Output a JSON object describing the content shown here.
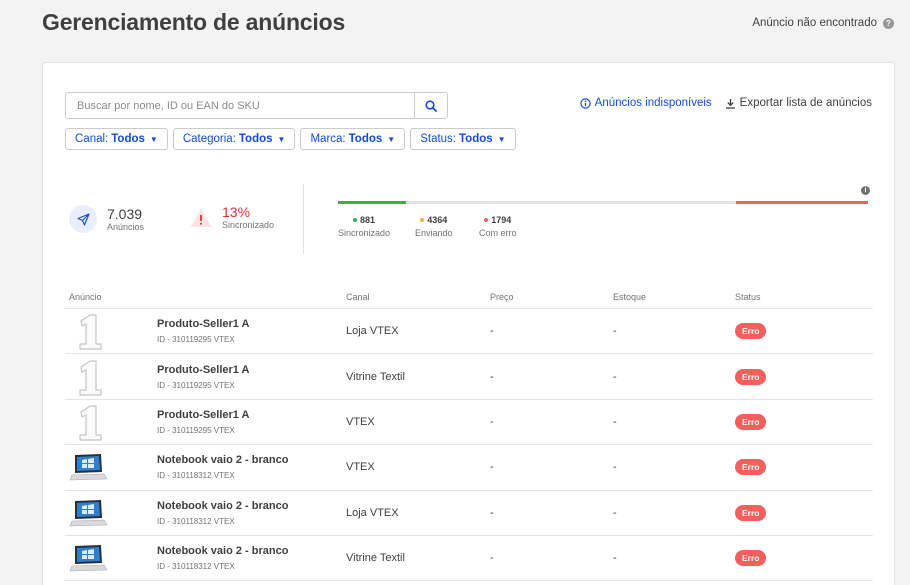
{
  "header": {
    "title": "Gerenciamento de anúncios",
    "help_link": "Anúncio não encontrado",
    "help_icon_glyph": "?"
  },
  "search": {
    "placeholder": "Buscar por nome, ID ou EAN do SKU",
    "value": ""
  },
  "links": {
    "unavailable": "Anúncios indisponíveis",
    "export": "Exportar lista de anúncios"
  },
  "filters": [
    {
      "label": "Canal:",
      "value": "Todos"
    },
    {
      "label": "Categoria:",
      "value": "Todos"
    },
    {
      "label": "Marca:",
      "value": "Todos"
    },
    {
      "label": "Status:",
      "value": "Todos"
    }
  ],
  "summary": {
    "ads_count": "7.039",
    "ads_label": "Anúncios",
    "sync_pct": "13%",
    "sync_label": "Sincronizado",
    "legend": [
      {
        "value": "881",
        "label": "Sincronizado",
        "color": "#34b347"
      },
      {
        "value": "4364",
        "label": "Enviando",
        "color": "#f0b33b"
      },
      {
        "value": "1794",
        "label": "Com erro",
        "color": "#f25f5c"
      }
    ]
  },
  "table": {
    "columns": [
      "Anúncio",
      "Canal",
      "Preço",
      "Estoque",
      "Status"
    ],
    "rows": [
      {
        "name": "Produto-Seller1 A",
        "id": "ID - 310119295 VTEX",
        "image": "number-one",
        "channel": "Loja VTEX",
        "price": "-",
        "stock": "-",
        "status": "Erro"
      },
      {
        "name": "Produto-Seller1 A",
        "id": "ID - 310119295 VTEX",
        "image": "number-one",
        "channel": "Vitrine Textil",
        "price": "-",
        "stock": "-",
        "status": "Erro"
      },
      {
        "name": "Produto-Seller1 A",
        "id": "ID - 310119295 VTEX",
        "image": "number-one",
        "channel": "VTEX",
        "price": "-",
        "stock": "-",
        "status": "Erro"
      },
      {
        "name": "Notebook vaio 2 - branco",
        "id": "ID - 310118312 VTEX",
        "image": "laptop",
        "channel": "VTEX",
        "price": "-",
        "stock": "-",
        "status": "Erro"
      },
      {
        "name": "Notebook vaio 2 - branco",
        "id": "ID - 310118312 VTEX",
        "image": "laptop",
        "channel": "Loja VTEX",
        "price": "-",
        "stock": "-",
        "status": "Erro"
      },
      {
        "name": "Notebook vaio 2 - branco",
        "id": "ID - 310118312 VTEX",
        "image": "laptop",
        "channel": "Vitrine Textil",
        "price": "-",
        "stock": "-",
        "status": "Erro"
      }
    ]
  },
  "colors": {
    "accent": "#134cd8",
    "error": "#f25f5c",
    "success": "#34b347",
    "text": "#3f3f40"
  }
}
